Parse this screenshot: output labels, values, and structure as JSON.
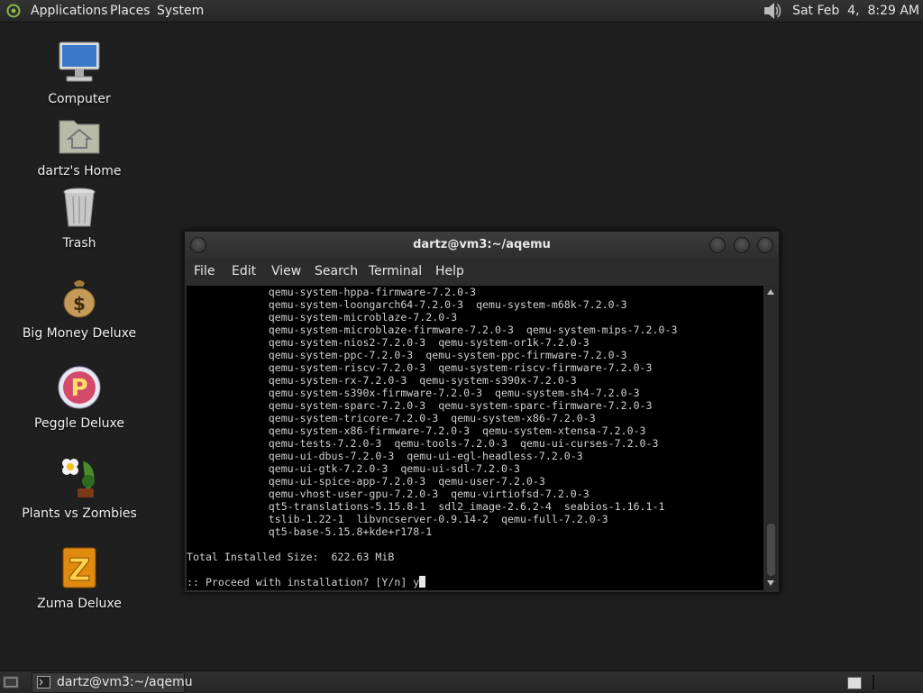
{
  "top_panel": {
    "menus": [
      "Applications",
      "Places",
      "System"
    ],
    "clock": "Sat Feb  4,  8:29 AM"
  },
  "desktop": {
    "icons": [
      {
        "label": "Computer",
        "icon": "computer-icon"
      },
      {
        "label": "dartz's Home",
        "icon": "home-folder-icon"
      },
      {
        "label": "Trash",
        "icon": "trash-icon"
      },
      {
        "label": "Big Money Deluxe",
        "icon": "money-bag-icon"
      },
      {
        "label": "Peggle Deluxe",
        "icon": "peggle-icon"
      },
      {
        "label": "Plants vs Zombies",
        "icon": "flower-icon"
      },
      {
        "label": "Zuma Deluxe",
        "icon": "zuma-icon"
      }
    ]
  },
  "terminal": {
    "title": "dartz@vm3:~/aqemu",
    "menu": [
      "File",
      "Edit",
      "View",
      "Search",
      "Terminal",
      "Help"
    ],
    "lines": [
      "             qemu-system-hppa-firmware-7.2.0-3",
      "             qemu-system-loongarch64-7.2.0-3  qemu-system-m68k-7.2.0-3",
      "             qemu-system-microblaze-7.2.0-3",
      "             qemu-system-microblaze-firmware-7.2.0-3  qemu-system-mips-7.2.0-3",
      "             qemu-system-nios2-7.2.0-3  qemu-system-or1k-7.2.0-3",
      "             qemu-system-ppc-7.2.0-3  qemu-system-ppc-firmware-7.2.0-3",
      "             qemu-system-riscv-7.2.0-3  qemu-system-riscv-firmware-7.2.0-3",
      "             qemu-system-rx-7.2.0-3  qemu-system-s390x-7.2.0-3",
      "             qemu-system-s390x-firmware-7.2.0-3  qemu-system-sh4-7.2.0-3",
      "             qemu-system-sparc-7.2.0-3  qemu-system-sparc-firmware-7.2.0-3",
      "             qemu-system-tricore-7.2.0-3  qemu-system-x86-7.2.0-3",
      "             qemu-system-x86-firmware-7.2.0-3  qemu-system-xtensa-7.2.0-3",
      "             qemu-tests-7.2.0-3  qemu-tools-7.2.0-3  qemu-ui-curses-7.2.0-3",
      "             qemu-ui-dbus-7.2.0-3  qemu-ui-egl-headless-7.2.0-3",
      "             qemu-ui-gtk-7.2.0-3  qemu-ui-sdl-7.2.0-3",
      "             qemu-ui-spice-app-7.2.0-3  qemu-user-7.2.0-3",
      "             qemu-vhost-user-gpu-7.2.0-3  qemu-virtiofsd-7.2.0-3",
      "             qt5-translations-5.15.8-1  sdl2_image-2.6.2-4  seabios-1.16.1-1",
      "             tslib-1.22-1  libvncserver-0.9.14-2  qemu-full-7.2.0-3",
      "             qt5-base-5.15.8+kde+r178-1",
      "",
      "Total Installed Size:  622.63 MiB",
      ""
    ],
    "prompt": ":: Proceed with installation? [Y/n] y"
  },
  "taskbar": {
    "task_label": "dartz@vm3:~/aqemu"
  }
}
